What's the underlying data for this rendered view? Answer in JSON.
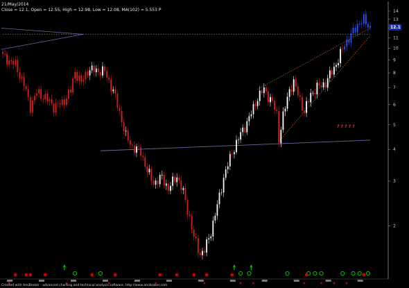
{
  "header": {
    "line1": "21/May/2014",
    "line2": "Close = 12.1,    Open = 12.55,    High = 12.98,    Low = 12.08,  MA(102) =    5.553    P"
  },
  "footer": {
    "credit": "Created with AmiBroker - advanced charting and technical analysis software. http://www.amibroker.com"
  },
  "annotation": "? ? ? ? ?",
  "colors": {
    "background": "#000000",
    "down_candle": "#d42020",
    "up_candle": "#ffffff",
    "recent_candle": "#2a50ff",
    "resistance_line": "#6a6aa8",
    "target_line": "#00b000",
    "trend_line": "#a0522d",
    "signal_green": "#00c000",
    "signal_red": "#d00000"
  },
  "chart_data": {
    "type": "candlestick",
    "title": "21/May/2014",
    "xlabel": "",
    "ylabel": "",
    "y_scale": "log",
    "ylim": [
      1.35,
      14
    ],
    "y_ticks": [
      1,
      2,
      3,
      4,
      5,
      6,
      7,
      8,
      9,
      10,
      11,
      12,
      13,
      14
    ],
    "last_value": 12.1,
    "grid": false,
    "x_start_index": 0,
    "x_end_index": 173,
    "price_path": [
      [
        0,
        9.3
      ],
      [
        6,
        8.6
      ],
      [
        10,
        7.2
      ],
      [
        13,
        5.9
      ],
      [
        16,
        6.7
      ],
      [
        20,
        6.4
      ],
      [
        24,
        5.9
      ],
      [
        28,
        6.1
      ],
      [
        32,
        6.8
      ],
      [
        34,
        8.1
      ],
      [
        37,
        7.3
      ],
      [
        40,
        8.2
      ],
      [
        43,
        8.2
      ],
      [
        48,
        8.1
      ],
      [
        52,
        6.8
      ],
      [
        55,
        5.6
      ],
      [
        58,
        4.5
      ],
      [
        61,
        4.1
      ],
      [
        65,
        3.9
      ],
      [
        68,
        3.3
      ],
      [
        71,
        2.95
      ],
      [
        75,
        3.1
      ],
      [
        78,
        2.8
      ],
      [
        82,
        3.15
      ],
      [
        85,
        2.7
      ],
      [
        88,
        2.15
      ],
      [
        90,
        1.8
      ],
      [
        93,
        1.55
      ],
      [
        95,
        1.6
      ],
      [
        98,
        1.9
      ],
      [
        101,
        2.4
      ],
      [
        104,
        3.1
      ],
      [
        108,
        3.9
      ],
      [
        112,
        4.6
      ],
      [
        116,
        5.3
      ],
      [
        120,
        6.4
      ],
      [
        123,
        6.9
      ],
      [
        127,
        6.1
      ],
      [
        129,
        5.5
      ],
      [
        130,
        4.4
      ],
      [
        132,
        5.4
      ],
      [
        135,
        6.9
      ],
      [
        137,
        7.3
      ],
      [
        140,
        6.3
      ],
      [
        142,
        5.6
      ],
      [
        145,
        6.6
      ],
      [
        148,
        7.0
      ],
      [
        152,
        7.3
      ],
      [
        155,
        8.1
      ],
      [
        158,
        9.0
      ],
      [
        161,
        10.4
      ],
      [
        164,
        11.2
      ],
      [
        167,
        12.4
      ],
      [
        170,
        12.9
      ],
      [
        173,
        12.1
      ]
    ],
    "overlays": {
      "support_line": {
        "x": [
          46,
          173
        ],
        "y": [
          3.95,
          4.35
        ]
      },
      "wedge_upper": {
        "x": [
          120,
          173
        ],
        "y": [
          6.9,
          12.0
        ]
      },
      "wedge_lower": {
        "x": [
          130,
          173
        ],
        "y": [
          4.3,
          11.2
        ]
      },
      "target_level": 11.35
    },
    "signals": {
      "green_circles": [
        34,
        46,
        112,
        116,
        134,
        144,
        147,
        150,
        160,
        165,
        168,
        172
      ],
      "red_circles": [
        6,
        11,
        13,
        20,
        42,
        53,
        74,
        82,
        90,
        96,
        108,
        143,
        170
      ],
      "green_arrows": [
        29,
        109,
        117
      ],
      "red_dots": [
        3,
        30,
        50,
        72,
        95,
        112,
        118,
        142,
        150,
        156,
        162
      ]
    }
  }
}
